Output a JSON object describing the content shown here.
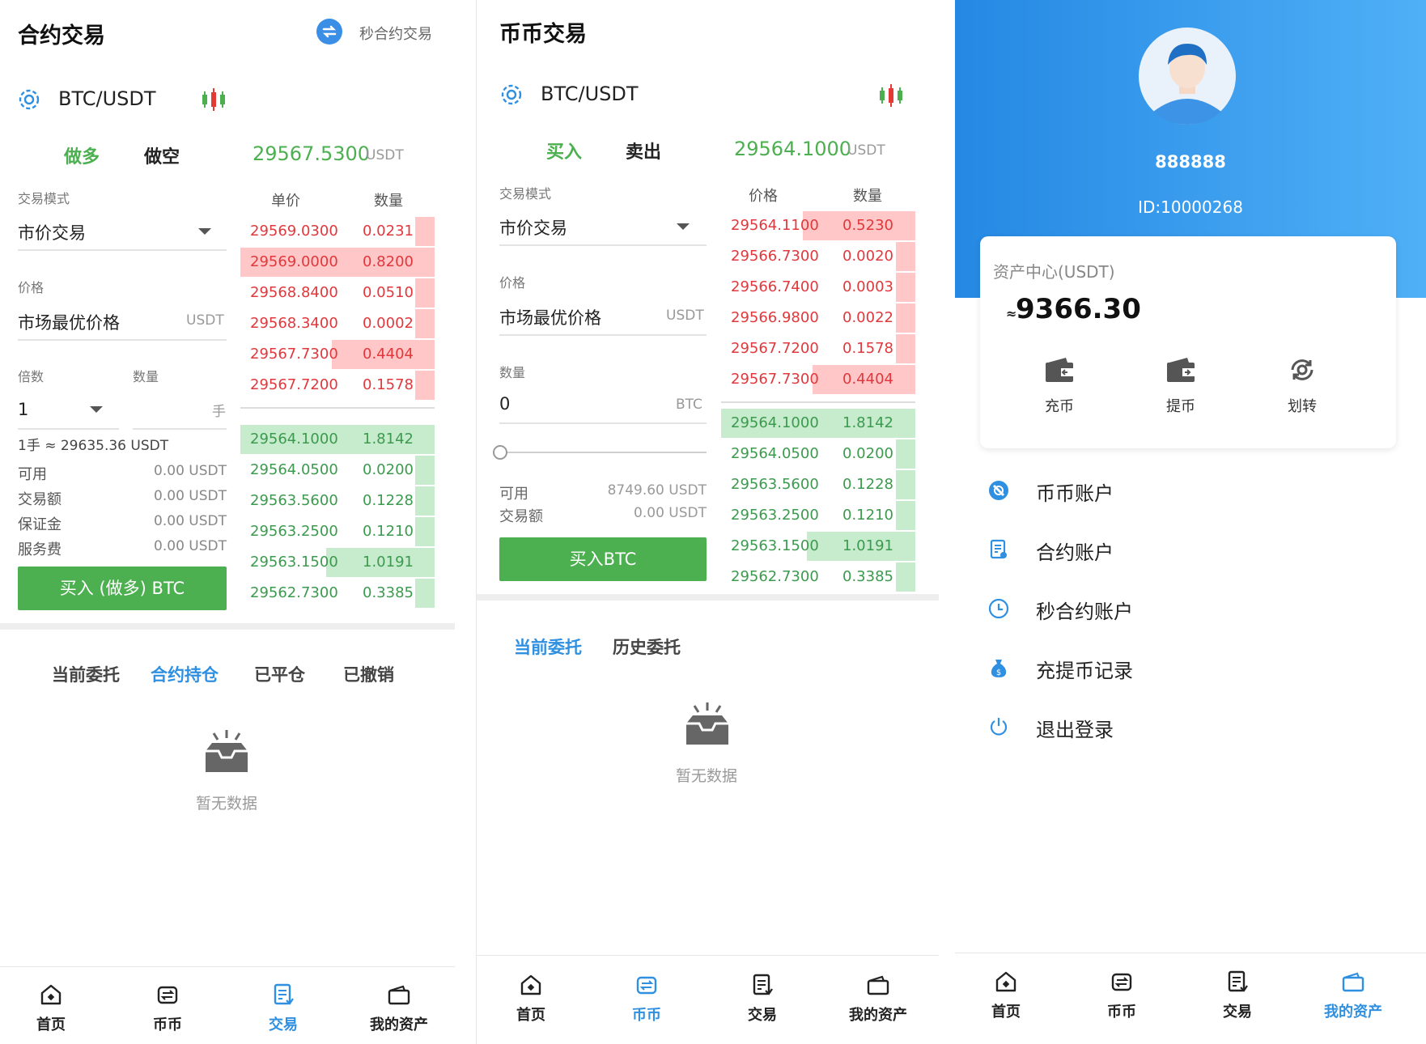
{
  "contract": {
    "title": "合约交易",
    "second_contract_link": "秒合约交易",
    "pair": "BTC/USDT",
    "tab_long": "做多",
    "tab_short": "做空",
    "price": "29567.5300",
    "price_unit": "USDT",
    "mode_label": "交易模式",
    "mode_value": "市价交易",
    "price_label": "价格",
    "price_value": "市场最优价格",
    "price_field_unit": "USDT",
    "leverage_label": "倍数",
    "qty_label": "数量",
    "leverage_value": "1",
    "qty_unit": "手",
    "lot_info": "1手 ≈ 29635.36 USDT",
    "stats": [
      {
        "label": "可用",
        "value": "0.00 USDT"
      },
      {
        "label": "交易额",
        "value": "0.00 USDT"
      },
      {
        "label": "保证金",
        "value": "0.00 USDT"
      },
      {
        "label": "服务费",
        "value": "0.00 USDT"
      }
    ],
    "buy_button": "买入 (做多) BTC",
    "ob_header_price": "单价",
    "ob_header_qty": "数量",
    "asks": [
      {
        "price": "29569.0300",
        "qty": "0.0231",
        "depth": 0.1
      },
      {
        "price": "29569.0000",
        "qty": "0.8200",
        "depth": 1.0
      },
      {
        "price": "29568.8400",
        "qty": "0.0510",
        "depth": 0.1
      },
      {
        "price": "29568.3400",
        "qty": "0.0002",
        "depth": 0.1
      },
      {
        "price": "29567.7300",
        "qty": "0.4404",
        "depth": 0.53
      },
      {
        "price": "29567.7200",
        "qty": "0.1578",
        "depth": 0.1
      }
    ],
    "bids": [
      {
        "price": "29564.1000",
        "qty": "1.8142",
        "depth": 1.0
      },
      {
        "price": "29564.0500",
        "qty": "0.0200",
        "depth": 0.1
      },
      {
        "price": "29563.5600",
        "qty": "0.1228",
        "depth": 0.1
      },
      {
        "price": "29563.2500",
        "qty": "0.1210",
        "depth": 0.1
      },
      {
        "price": "29563.1500",
        "qty": "1.0191",
        "depth": 0.56
      },
      {
        "price": "29562.7300",
        "qty": "0.3385",
        "depth": 0.1
      }
    ],
    "order_tabs": [
      "当前委托",
      "合约持仓",
      "已平仓",
      "已撤销"
    ],
    "active_order_tab": 1,
    "empty_text": "暂无数据"
  },
  "spot": {
    "title": "币币交易",
    "pair": "BTC/USDT",
    "tab_buy": "买入",
    "tab_sell": "卖出",
    "price": "29564.1000",
    "price_unit": "USDT",
    "mode_label": "交易模式",
    "mode_value": "市价交易",
    "price_label": "价格",
    "price_value": "市场最优价格",
    "price_field_unit": "USDT",
    "qty_label": "数量",
    "qty_value": "0",
    "qty_unit": "BTC",
    "slider_value": 0,
    "available_label": "可用",
    "available_value": "8749.60 USDT",
    "amount_label": "交易额",
    "amount_value": "0.00 USDT",
    "buy_button": "买入BTC",
    "ob_header_price": "价格",
    "ob_header_qty": "数量",
    "asks": [
      {
        "price": "29564.1100",
        "qty": "0.5230",
        "depth": 0.58
      },
      {
        "price": "29566.7300",
        "qty": "0.0020",
        "depth": 0.1
      },
      {
        "price": "29566.7400",
        "qty": "0.0003",
        "depth": 0.1
      },
      {
        "price": "29566.9800",
        "qty": "0.0022",
        "depth": 0.1
      },
      {
        "price": "29567.7200",
        "qty": "0.1578",
        "depth": 0.1
      },
      {
        "price": "29567.7300",
        "qty": "0.4404",
        "depth": 0.53
      }
    ],
    "bids": [
      {
        "price": "29564.1000",
        "qty": "1.8142",
        "depth": 1.0
      },
      {
        "price": "29564.0500",
        "qty": "0.0200",
        "depth": 0.1
      },
      {
        "price": "29563.5600",
        "qty": "0.1228",
        "depth": 0.1
      },
      {
        "price": "29563.2500",
        "qty": "0.1210",
        "depth": 0.1
      },
      {
        "price": "29563.1500",
        "qty": "1.0191",
        "depth": 0.56
      },
      {
        "price": "29562.7300",
        "qty": "0.3385",
        "depth": 0.1
      }
    ],
    "order_tabs": [
      "当前委托",
      "历史委托"
    ],
    "active_order_tab": 0,
    "empty_text": "暂无数据"
  },
  "assets": {
    "username": "888888",
    "user_id": "ID:10000268",
    "card_title": "资产中心(USDT)",
    "balance_prefix": "≈",
    "balance": "9366.30",
    "actions": [
      {
        "label": "充币",
        "icon": "wallet-icon"
      },
      {
        "label": "提币",
        "icon": "wallet-out-icon"
      },
      {
        "label": "划转",
        "icon": "transfer-icon"
      }
    ],
    "menu": [
      {
        "label": "币币账户",
        "icon": "coin-account-icon"
      },
      {
        "label": "合约账户",
        "icon": "contract-account-icon"
      },
      {
        "label": "秒合约账户",
        "icon": "clock-icon"
      },
      {
        "label": "充提币记录",
        "icon": "moneybag-icon"
      },
      {
        "label": "退出登录",
        "icon": "power-icon"
      }
    ]
  },
  "nav": {
    "items": [
      "首页",
      "币币",
      "交易",
      "我的资产"
    ]
  },
  "colors": {
    "green": "#4caf50",
    "red": "#e53935",
    "blue": "#2f8fe0",
    "header_blue": "#2b8fe6"
  }
}
